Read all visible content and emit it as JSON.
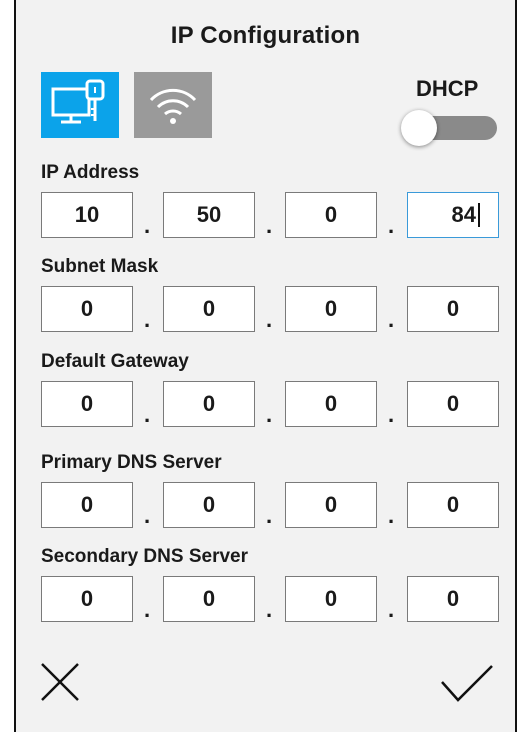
{
  "dialog": {
    "title": "IP Configuration",
    "dhcp_label": "DHCP",
    "dhcp_enabled": false,
    "wired_tab_icon": "ethernet-monitor-icon",
    "wifi_tab_icon": "wifi-icon",
    "accent_color": "#0ba3ea",
    "inactive_color": "#9a9a9a",
    "cancel_icon": "close-icon",
    "confirm_icon": "checkmark-icon"
  },
  "fields": [
    {
      "label": "IP Address",
      "octets": [
        "10",
        "50",
        "0",
        "84"
      ]
    },
    {
      "label": "Subnet Mask",
      "octets": [
        "0",
        "0",
        "0",
        "0"
      ]
    },
    {
      "label": "Default Gateway",
      "octets": [
        "0",
        "0",
        "0",
        "0"
      ]
    },
    {
      "label": "Primary DNS Server",
      "octets": [
        "0",
        "0",
        "0",
        "0"
      ]
    },
    {
      "label": "Secondary DNS Server",
      "octets": [
        "0",
        "0",
        "0",
        "0"
      ]
    }
  ],
  "separator": "."
}
